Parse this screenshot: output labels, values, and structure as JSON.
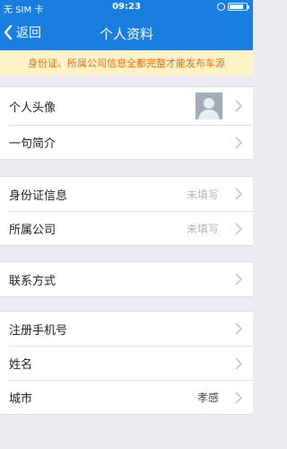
{
  "status_bar": {
    "carrier": "无 SIM 卡",
    "time": "09:23"
  },
  "nav": {
    "back_label": "返回",
    "title": "个人资料"
  },
  "notice": "身份证、所属公司信息全都完整才能发布车源",
  "groups": {
    "profile": {
      "avatar_label": "个人头像",
      "intro_label": "一句简介"
    },
    "identity": {
      "id_label": "身份证信息",
      "id_value": "未填写",
      "company_label": "所属公司",
      "company_value": "未填写"
    },
    "contact": {
      "label": "联系方式"
    },
    "account": {
      "phone_label": "注册手机号",
      "phone_value": "",
      "name_label": "姓名",
      "name_value": "",
      "city_label": "城市",
      "city_value": "孝感"
    }
  },
  "colors": {
    "accent": "#1a7ee0",
    "notice_bg": "#fdf3c6",
    "notice_text": "#f26d12",
    "page_bg": "#ebebf1"
  }
}
